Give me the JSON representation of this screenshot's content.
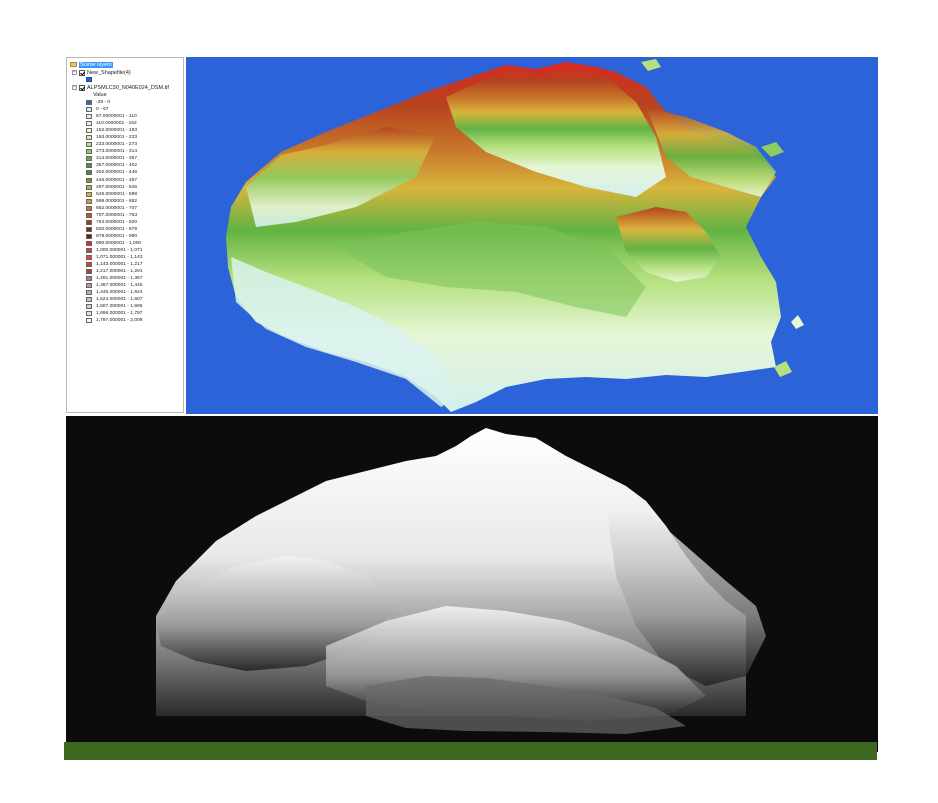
{
  "toc": {
    "root": "Scene layers",
    "layer1": "New_Shapefile(4)",
    "layer2": "ALPSMLC30_N040E024_DSM.tif",
    "value_header": "Value"
  },
  "legend": [
    {
      "label": "-28 - 0",
      "color": "#2d63d8"
    },
    {
      "label": "0 - 67",
      "color": "#d3f0ef"
    },
    {
      "label": "67.00000001 - 110",
      "color": "#d8f3de"
    },
    {
      "label": "110.0000001 - 152",
      "color": "#e6f6d6"
    },
    {
      "label": "152.0000001 - 193",
      "color": "#f3f8c8"
    },
    {
      "label": "193.0000001 - 233",
      "color": "#d7ee9a"
    },
    {
      "label": "233.0000001 - 273",
      "color": "#b5e07e"
    },
    {
      "label": "273.0000001 - 314",
      "color": "#8dcc5e"
    },
    {
      "label": "314.0000001 - 357",
      "color": "#62b344"
    },
    {
      "label": "357.0000001 - 402",
      "color": "#3f9a35"
    },
    {
      "label": "402.0000001 - 446",
      "color": "#4d8f2f"
    },
    {
      "label": "446.0000001 - 497",
      "color": "#7d9a34"
    },
    {
      "label": "497.0000001 - 546",
      "color": "#b4b23a"
    },
    {
      "label": "546.0000001 - 598",
      "color": "#d8b43c"
    },
    {
      "label": "598.0000001 - 652",
      "color": "#d99a32"
    },
    {
      "label": "652.0000001 - 707",
      "color": "#c8762a"
    },
    {
      "label": "707.0000001 - 763",
      "color": "#b55a24"
    },
    {
      "label": "763.0000001 - 820",
      "color": "#9a4020"
    },
    {
      "label": "820.0000001 - 879",
      "color": "#7a2a18"
    },
    {
      "label": "879.0000001 - 990",
      "color": "#6a1c14"
    },
    {
      "label": "990.0000001 - 1,000",
      "color": "#d82a22"
    },
    {
      "label": "1,000.000001 - 1,071",
      "color": "#e83a2e"
    },
    {
      "label": "1,071.000001 - 1,143",
      "color": "#e24a3a"
    },
    {
      "label": "1,143.000001 - 1,217",
      "color": "#c8463a"
    },
    {
      "label": "1,217.000001 - 1,291",
      "color": "#b43a32"
    },
    {
      "label": "1,291.000001 - 1,367",
      "color": "#a08a80"
    },
    {
      "label": "1,367.000001 - 1,445",
      "color": "#ae9e96"
    },
    {
      "label": "1,445.000001 - 1,524",
      "color": "#bcb0aa"
    },
    {
      "label": "1,524.000001 - 1,607",
      "color": "#c9c0bc"
    },
    {
      "label": "1,607.000001 - 1,696",
      "color": "#d6d0cd"
    },
    {
      "label": "1,696.000001 - 1,797",
      "color": "#e4e0de"
    },
    {
      "label": "1,797.000001 - 2,009",
      "color": "#f6f6f6"
    }
  ],
  "colors": {
    "sea": "#2d63d8",
    "lowland": "#d3f0ef",
    "midland": "#62b344",
    "highland": "#b55a24",
    "peak": "#d82a22",
    "dsm_background": "#0c0c0c",
    "ground": "#3e6a20"
  }
}
